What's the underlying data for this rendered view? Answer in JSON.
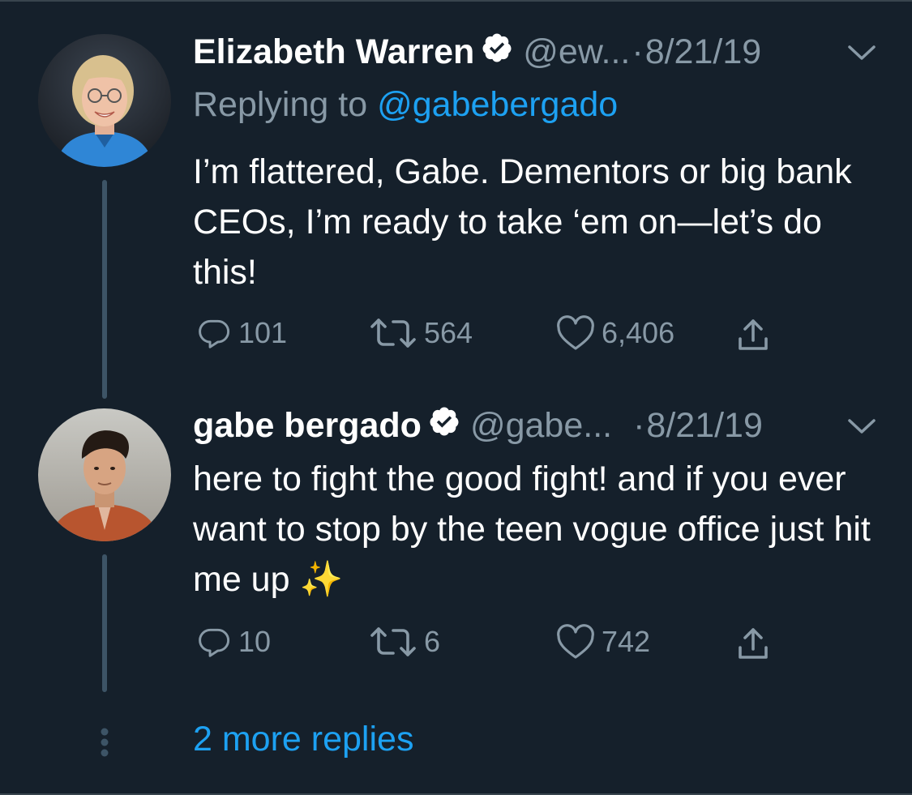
{
  "tweets": [
    {
      "name": "Elizabeth Warren",
      "handle": "@ew...",
      "dot": "·",
      "date": "8/21/19",
      "replying_prefix": "Replying to",
      "replying_to": "@gabebergado",
      "text": "I’m flattered, Gabe. Dementors or big bank CEOs, I’m ready to take ‘em on—let’s do this!",
      "replies": "101",
      "retweets": "564",
      "likes": "6,406"
    },
    {
      "name": "gabe bergado",
      "handle": "@gabe...",
      "dot": "·",
      "date": "8/21/19",
      "text": "here to fight the good fight! and if you ever want to stop by the teen vogue office just hit me up",
      "emoji": "✨",
      "replies": "10",
      "retweets": "6",
      "likes": "742"
    }
  ],
  "more_replies": "2 more replies",
  "colors": {
    "background": "#15202b",
    "text": "#ffffff",
    "secondary": "#8899a6",
    "link": "#1da1f2",
    "thread_line": "#3d5466"
  },
  "icons": [
    "verified-badge-icon",
    "chevron-down-icon",
    "reply-icon",
    "retweet-icon",
    "like-icon",
    "share-icon",
    "more-dots-icon"
  ]
}
